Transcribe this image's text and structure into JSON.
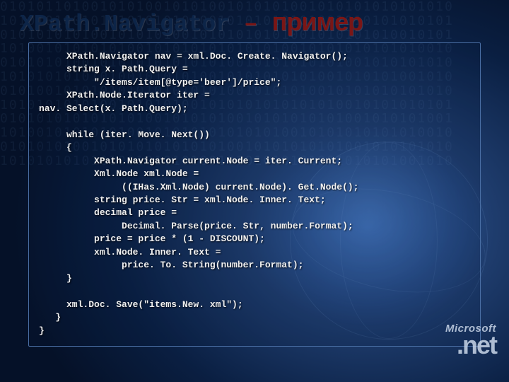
{
  "title": {
    "main": "XPath.Navigator",
    "dash": "–",
    "suffix": "пример"
  },
  "code": "     XPath.Navigator nav = xml.Doc. Create. Navigator();\n     string x. Path.Query =\n          \"/items/item[@type='beer']/price\";\n     XPath.Node.Iterator iter =\nnav. Select(x. Path.Query);\n\n     while (iter. Move. Next())\n     {\n          XPath.Navigator current.Node = iter. Current;\n          Xml.Node xml.Node =\n               ((IHas.Xml.Node) current.Node). Get.Node();\n          string price. Str = xml.Node. Inner. Text;\n          decimal price =\n               Decimal. Parse(price. Str, number.Format);\n          price = price * (1 - DISCOUNT);\n          xml.Node. Inner. Text =\n               price. To. String(number.Format);\n     }\n\n     xml.Doc. Save(\"items.New. xml\");\n   }\n}",
  "logo": {
    "brand": "Microsoft",
    "product": ".net"
  },
  "binary": "01010110100101010010101001010101001010101010101010\n10101010010101010101010010101010101001010101010101\n01010101010010101010010101010101001010101010010101\n10100101010101001010101010101010010101010101010010\n01010101001010101010101010010101010101001010101010\n10101010101010010101010010101010101001010101001010\n01010010101010101010101010010101010010101010101010\n10101010101001010101001010101010101010010101010101\n01010101010101010010101010010101010101001010101001\n10100101010101001010101010101010010101010101010010\n01010101001010101010101010010101010101001010101010\n10101010101010010101010010101010101001010101001010"
}
